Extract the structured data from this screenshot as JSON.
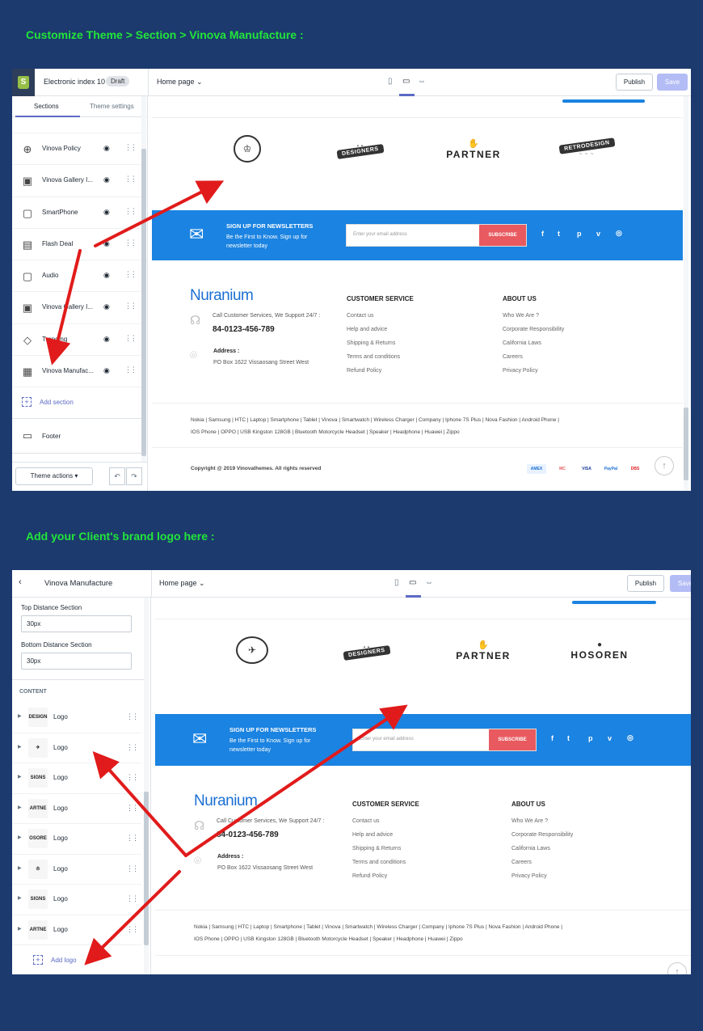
{
  "headings": {
    "first": "Customize Theme > Section > Vinova Manufacture :",
    "second": "Add your Client's brand logo here :"
  },
  "colors": {
    "background": "#1c3a6e",
    "heading": "#22e53a",
    "accent": "#5c6ac4",
    "newsletter": "#1b83e1",
    "subscribe": "#e85a5f",
    "arrow": "#e11b1b"
  },
  "editor1": {
    "store_name": "Electronic index 10",
    "draft_badge": "Draft",
    "page_select": "Home page",
    "publish": "Publish",
    "save": "Save",
    "tabs": [
      "Sections",
      "Theme settings"
    ],
    "sections": [
      {
        "label": "Vinova Policy",
        "icon": "policy-icon"
      },
      {
        "label": "Vinova Gallery I...",
        "icon": "gallery-icon"
      },
      {
        "label": "SmartPhone",
        "icon": "collection-icon"
      },
      {
        "label": "Flash Deal",
        "icon": "product-icon"
      },
      {
        "label": "Audio",
        "icon": "collection-icon"
      },
      {
        "label": "Vinova Gallery I...",
        "icon": "gallery-icon"
      },
      {
        "label": "Trending",
        "icon": "tag-icon"
      },
      {
        "label": "Vinova Manufac...",
        "icon": "manufacture-icon"
      }
    ],
    "add_section": "Add section",
    "footer": "Footer",
    "theme_actions": "Theme actions"
  },
  "editor2": {
    "title": "Vinova Manufacture",
    "page_select": "Home page",
    "publish": "Publish",
    "save": "Save",
    "top_distance_label": "Top Distance Section",
    "top_distance_value": "30px",
    "bottom_distance_label": "Bottom Distance Section",
    "bottom_distance_value": "30px",
    "content_heading": "CONTENT",
    "logos": [
      {
        "label": "Logo",
        "thumb": "DESIGN"
      },
      {
        "label": "Logo",
        "thumb": "✈"
      },
      {
        "label": "Logo",
        "thumb": "SIGNS"
      },
      {
        "label": "Logo",
        "thumb": "ARTNE"
      },
      {
        "label": "Logo",
        "thumb": "OSORE"
      },
      {
        "label": "Logo",
        "thumb": "♔"
      },
      {
        "label": "Logo",
        "thumb": "SIGNS"
      },
      {
        "label": "Logo",
        "thumb": "ARTNE"
      }
    ],
    "add_logo": "Add logo"
  },
  "preview1": {
    "brands": [
      "♔",
      "DESIGNERS",
      "PARTNER",
      "RETRODESIGN"
    ]
  },
  "preview2": {
    "brands": [
      "✈",
      "DESIGNERS",
      "PARTNER",
      "HOSOREN"
    ]
  },
  "site": {
    "newsletter_title": "SIGN UP FOR NEWSLETTERS",
    "newsletter_sub": "Be the First to Know. Sign up for newsletter today",
    "email_placeholder": "Enter your email address",
    "subscribe": "SUBSCRIBE",
    "social": [
      "f",
      "t",
      "p",
      "v",
      "◎"
    ],
    "brand_name": "Nuranium",
    "call_text": "Call Customer Services, We Support 24/7 :",
    "phone": "84-0123-456-789",
    "address_label": "Address :",
    "address": "PO Box 1622 Vissaosang Street West",
    "customer_service_title": "CUSTOMER SERVICE",
    "customer_service": [
      "Contact us",
      "Help and advice",
      "Shipping & Returns",
      "Terms and conditions",
      "Refund Policy"
    ],
    "about_title": "ABOUT US",
    "about": [
      "Who We Are ?",
      "Corporate Responsibility",
      "California Laws",
      "Careers",
      "Privacy Policy"
    ],
    "tags_line1": "Nokia  |  Samsung  |  HTC  |  Laptop  |  Smartphone  |  Tablet  |  Vinova  |  Smartwatch  |  Wireless Charger  |  Company  |  Iphone 7S Plus  |  Nova Fashion  |  Android Phone  |",
    "tags_line2": "IOS Phone  |  OPPO  |  USB Kingston 128GB  |  Bluetooth Motorcycle Headset  |  Speaker  |  Headphone  |  Huawei  |  Zippo",
    "copyright": "Copyright @ 2019 Vinovathemes. All rights reserved",
    "payments": [
      "AMEX",
      "MC",
      "VISA",
      "PayPal",
      "DBS"
    ]
  }
}
